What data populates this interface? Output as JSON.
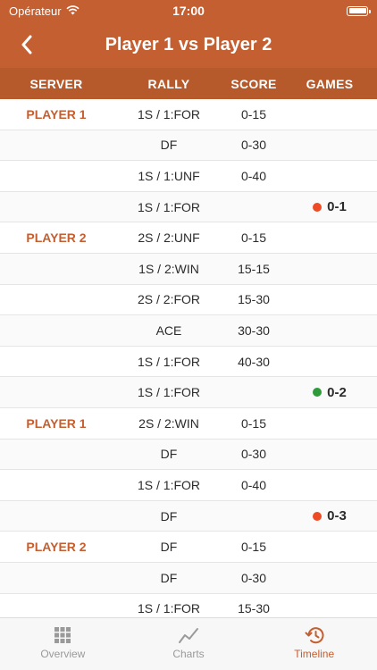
{
  "status": {
    "carrier": "Opérateur",
    "time": "17:00"
  },
  "nav": {
    "title": "Player 1 vs Player 2"
  },
  "columns": {
    "server": "SERVER",
    "rally": "RALLY",
    "score": "SCORE",
    "games": "GAMES"
  },
  "colors": {
    "accent": "#c35f30",
    "red_dot": "#ee4a25",
    "green_dot": "#2e9a3a"
  },
  "rows": [
    {
      "server": "PLAYER 1",
      "rally": "1S / 1:FOR",
      "score": "0-15",
      "games": ""
    },
    {
      "server": "",
      "rally": "DF",
      "score": "0-30",
      "games": ""
    },
    {
      "server": "",
      "rally": "1S / 1:UNF",
      "score": "0-40",
      "games": ""
    },
    {
      "server": "",
      "rally": "1S / 1:FOR",
      "score": "",
      "games": "0-1",
      "dot": "red"
    },
    {
      "server": "PLAYER 2",
      "rally": "2S / 2:UNF",
      "score": "0-15",
      "games": ""
    },
    {
      "server": "",
      "rally": "1S / 2:WIN",
      "score": "15-15",
      "games": ""
    },
    {
      "server": "",
      "rally": "2S / 2:FOR",
      "score": "15-30",
      "games": ""
    },
    {
      "server": "",
      "rally": "ACE",
      "score": "30-30",
      "games": ""
    },
    {
      "server": "",
      "rally": "1S / 1:FOR",
      "score": "40-30",
      "games": ""
    },
    {
      "server": "",
      "rally": "1S / 1:FOR",
      "score": "",
      "games": "0-2",
      "dot": "green"
    },
    {
      "server": "PLAYER 1",
      "rally": "2S / 2:WIN",
      "score": "0-15",
      "games": ""
    },
    {
      "server": "",
      "rally": "DF",
      "score": "0-30",
      "games": ""
    },
    {
      "server": "",
      "rally": "1S / 1:FOR",
      "score": "0-40",
      "games": ""
    },
    {
      "server": "",
      "rally": "DF",
      "score": "",
      "games": "0-3",
      "dot": "red"
    },
    {
      "server": "PLAYER 2",
      "rally": "DF",
      "score": "0-15",
      "games": ""
    },
    {
      "server": "",
      "rally": "DF",
      "score": "0-30",
      "games": ""
    },
    {
      "server": "",
      "rally": "1S / 1:FOR",
      "score": "15-30",
      "games": ""
    }
  ],
  "tabs": [
    {
      "label": "Overview",
      "icon": "grid-icon",
      "active": false
    },
    {
      "label": "Charts",
      "icon": "chart-line-icon",
      "active": false
    },
    {
      "label": "Timeline",
      "icon": "history-icon",
      "active": true
    }
  ]
}
